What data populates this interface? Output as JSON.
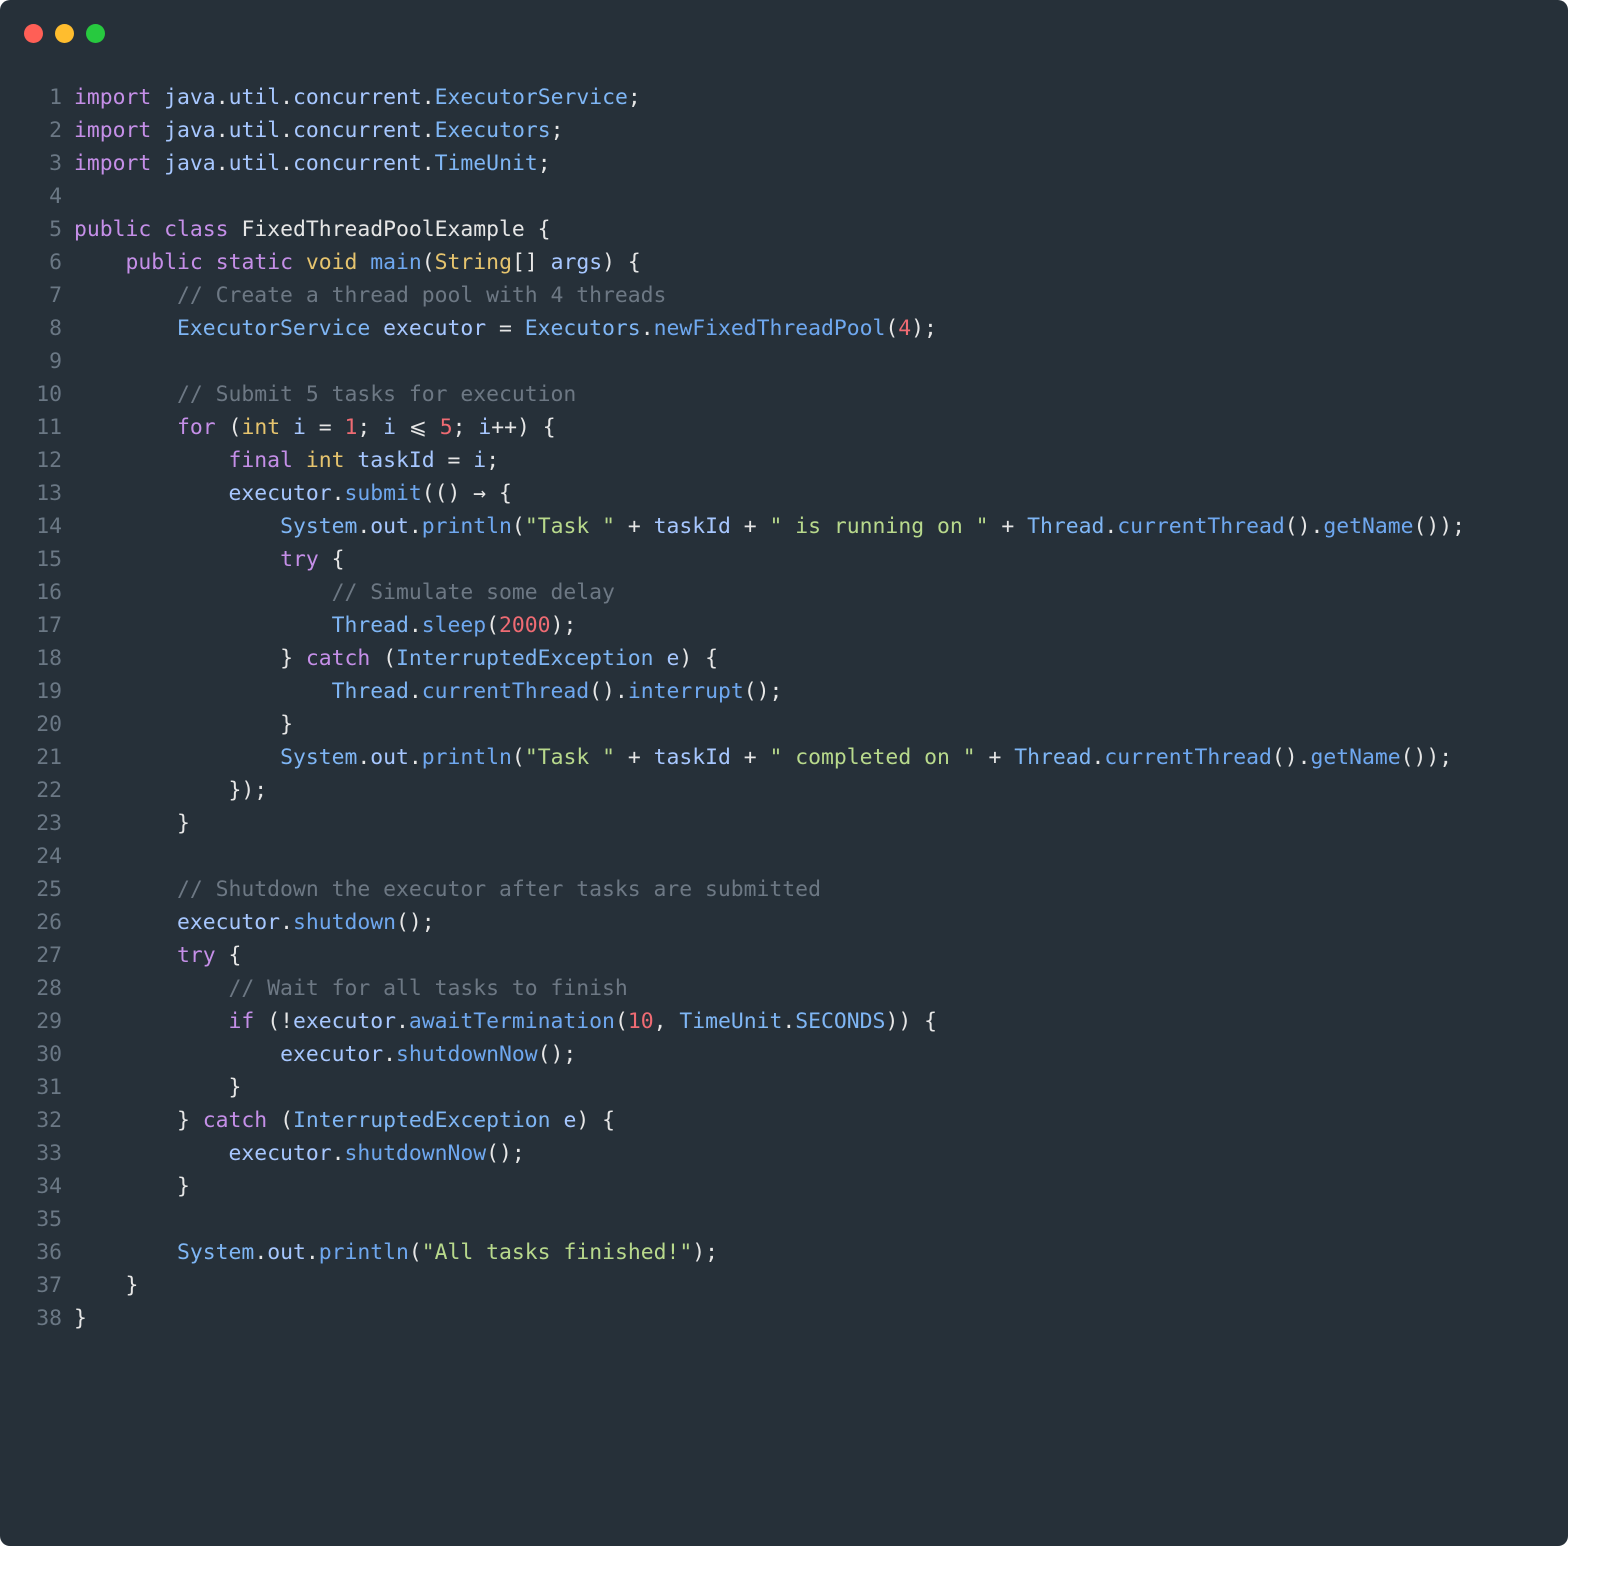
{
  "window": {
    "traffic_lights": [
      {
        "name": "close",
        "color": "#ff5f56"
      },
      {
        "name": "minimize",
        "color": "#ffbd2e"
      },
      {
        "name": "zoom",
        "color": "#27c93f"
      }
    ]
  },
  "editor": {
    "background": "#263039",
    "line_number_color": "#6b7885",
    "colors": {
      "plain": "#e6e6e6",
      "kw": "#c58fe8",
      "type": "#e6c46e",
      "fn": "#6fa8f0",
      "cls": "#7fb6f5",
      "var": "#a7c7ff",
      "num": "#ef6b73",
      "str": "#b8d98c",
      "com": "#6d7884",
      "punc": "#e6e6e6"
    },
    "lines": [
      {
        "n": "1",
        "tokens": [
          [
            "kw",
            "import"
          ],
          [
            "plain",
            " "
          ],
          [
            "var",
            "java"
          ],
          [
            "punc",
            "."
          ],
          [
            "var",
            "util"
          ],
          [
            "punc",
            "."
          ],
          [
            "var",
            "concurrent"
          ],
          [
            "punc",
            "."
          ],
          [
            "cls",
            "ExecutorService"
          ],
          [
            "punc",
            ";"
          ]
        ]
      },
      {
        "n": "2",
        "tokens": [
          [
            "kw",
            "import"
          ],
          [
            "plain",
            " "
          ],
          [
            "var",
            "java"
          ],
          [
            "punc",
            "."
          ],
          [
            "var",
            "util"
          ],
          [
            "punc",
            "."
          ],
          [
            "var",
            "concurrent"
          ],
          [
            "punc",
            "."
          ],
          [
            "cls",
            "Executors"
          ],
          [
            "punc",
            ";"
          ]
        ]
      },
      {
        "n": "3",
        "tokens": [
          [
            "kw",
            "import"
          ],
          [
            "plain",
            " "
          ],
          [
            "var",
            "java"
          ],
          [
            "punc",
            "."
          ],
          [
            "var",
            "util"
          ],
          [
            "punc",
            "."
          ],
          [
            "var",
            "concurrent"
          ],
          [
            "punc",
            "."
          ],
          [
            "cls",
            "TimeUnit"
          ],
          [
            "punc",
            ";"
          ]
        ]
      },
      {
        "n": "4",
        "tokens": []
      },
      {
        "n": "5",
        "tokens": [
          [
            "kw",
            "public"
          ],
          [
            "plain",
            " "
          ],
          [
            "kw",
            "class"
          ],
          [
            "plain",
            " FixedThreadPoolExample {"
          ]
        ]
      },
      {
        "n": "6",
        "tokens": [
          [
            "plain",
            "    "
          ],
          [
            "kw",
            "public"
          ],
          [
            "plain",
            " "
          ],
          [
            "kw",
            "static"
          ],
          [
            "plain",
            " "
          ],
          [
            "type",
            "void"
          ],
          [
            "plain",
            " "
          ],
          [
            "fn",
            "main"
          ],
          [
            "punc",
            "("
          ],
          [
            "type",
            "String"
          ],
          [
            "punc",
            "[] "
          ],
          [
            "var",
            "args"
          ],
          [
            "punc",
            ") {"
          ]
        ]
      },
      {
        "n": "7",
        "tokens": [
          [
            "plain",
            "        "
          ],
          [
            "com",
            "// Create a thread pool with 4 threads"
          ]
        ]
      },
      {
        "n": "8",
        "tokens": [
          [
            "plain",
            "        "
          ],
          [
            "cls",
            "ExecutorService"
          ],
          [
            "plain",
            " "
          ],
          [
            "var",
            "executor"
          ],
          [
            "punc",
            " = "
          ],
          [
            "cls",
            "Executors"
          ],
          [
            "punc",
            "."
          ],
          [
            "fn",
            "newFixedThreadPool"
          ],
          [
            "punc",
            "("
          ],
          [
            "num",
            "4"
          ],
          [
            "punc",
            ");"
          ]
        ]
      },
      {
        "n": "9",
        "tokens": []
      },
      {
        "n": "10",
        "tokens": [
          [
            "plain",
            "        "
          ],
          [
            "com",
            "// Submit 5 tasks for execution"
          ]
        ]
      },
      {
        "n": "11",
        "tokens": [
          [
            "plain",
            "        "
          ],
          [
            "kw",
            "for"
          ],
          [
            "punc",
            " ("
          ],
          [
            "type",
            "int"
          ],
          [
            "plain",
            " "
          ],
          [
            "var",
            "i"
          ],
          [
            "punc",
            " = "
          ],
          [
            "num",
            "1"
          ],
          [
            "punc",
            "; "
          ],
          [
            "var",
            "i"
          ],
          [
            "punc",
            " ⩽ "
          ],
          [
            "num",
            "5"
          ],
          [
            "punc",
            "; "
          ],
          [
            "var",
            "i"
          ],
          [
            "punc",
            "++) {"
          ]
        ]
      },
      {
        "n": "12",
        "tokens": [
          [
            "plain",
            "            "
          ],
          [
            "kw",
            "final"
          ],
          [
            "plain",
            " "
          ],
          [
            "type",
            "int"
          ],
          [
            "plain",
            " "
          ],
          [
            "var",
            "taskId"
          ],
          [
            "punc",
            " = "
          ],
          [
            "var",
            "i"
          ],
          [
            "punc",
            ";"
          ]
        ]
      },
      {
        "n": "13",
        "tokens": [
          [
            "plain",
            "            "
          ],
          [
            "var",
            "executor"
          ],
          [
            "punc",
            "."
          ],
          [
            "fn",
            "submit"
          ],
          [
            "punc",
            "(() → {"
          ]
        ]
      },
      {
        "n": "14",
        "tokens": [
          [
            "plain",
            "                "
          ],
          [
            "cls",
            "System"
          ],
          [
            "punc",
            "."
          ],
          [
            "var",
            "out"
          ],
          [
            "punc",
            "."
          ],
          [
            "fn",
            "println"
          ],
          [
            "punc",
            "("
          ],
          [
            "str",
            "\"Task \""
          ],
          [
            "punc",
            " + "
          ],
          [
            "var",
            "taskId"
          ],
          [
            "punc",
            " + "
          ],
          [
            "str",
            "\" is running on \""
          ],
          [
            "punc",
            " + "
          ],
          [
            "cls",
            "Thread"
          ],
          [
            "punc",
            "."
          ],
          [
            "fn",
            "currentThread"
          ],
          [
            "punc",
            "()."
          ],
          [
            "fn",
            "getName"
          ],
          [
            "punc",
            "());"
          ]
        ]
      },
      {
        "n": "15",
        "tokens": [
          [
            "plain",
            "                "
          ],
          [
            "kw",
            "try"
          ],
          [
            "punc",
            " {"
          ]
        ]
      },
      {
        "n": "16",
        "tokens": [
          [
            "plain",
            "                    "
          ],
          [
            "com",
            "// Simulate some delay"
          ]
        ]
      },
      {
        "n": "17",
        "tokens": [
          [
            "plain",
            "                    "
          ],
          [
            "cls",
            "Thread"
          ],
          [
            "punc",
            "."
          ],
          [
            "fn",
            "sleep"
          ],
          [
            "punc",
            "("
          ],
          [
            "num",
            "2000"
          ],
          [
            "punc",
            ");"
          ]
        ]
      },
      {
        "n": "18",
        "tokens": [
          [
            "plain",
            "                "
          ],
          [
            "punc",
            "} "
          ],
          [
            "kw",
            "catch"
          ],
          [
            "punc",
            " ("
          ],
          [
            "cls",
            "InterruptedException"
          ],
          [
            "plain",
            " "
          ],
          [
            "var",
            "e"
          ],
          [
            "punc",
            ") {"
          ]
        ]
      },
      {
        "n": "19",
        "tokens": [
          [
            "plain",
            "                    "
          ],
          [
            "cls",
            "Thread"
          ],
          [
            "punc",
            "."
          ],
          [
            "fn",
            "currentThread"
          ],
          [
            "punc",
            "()."
          ],
          [
            "fn",
            "interrupt"
          ],
          [
            "punc",
            "();"
          ]
        ]
      },
      {
        "n": "20",
        "tokens": [
          [
            "plain",
            "                "
          ],
          [
            "punc",
            "}"
          ]
        ]
      },
      {
        "n": "21",
        "tokens": [
          [
            "plain",
            "                "
          ],
          [
            "cls",
            "System"
          ],
          [
            "punc",
            "."
          ],
          [
            "var",
            "out"
          ],
          [
            "punc",
            "."
          ],
          [
            "fn",
            "println"
          ],
          [
            "punc",
            "("
          ],
          [
            "str",
            "\"Task \""
          ],
          [
            "punc",
            " + "
          ],
          [
            "var",
            "taskId"
          ],
          [
            "punc",
            " + "
          ],
          [
            "str",
            "\" completed on \""
          ],
          [
            "punc",
            " + "
          ],
          [
            "cls",
            "Thread"
          ],
          [
            "punc",
            "."
          ],
          [
            "fn",
            "currentThread"
          ],
          [
            "punc",
            "()."
          ],
          [
            "fn",
            "getName"
          ],
          [
            "punc",
            "());"
          ]
        ]
      },
      {
        "n": "22",
        "tokens": [
          [
            "plain",
            "            "
          ],
          [
            "punc",
            "});"
          ]
        ]
      },
      {
        "n": "23",
        "tokens": [
          [
            "plain",
            "        "
          ],
          [
            "punc",
            "}"
          ]
        ]
      },
      {
        "n": "24",
        "tokens": []
      },
      {
        "n": "25",
        "tokens": [
          [
            "plain",
            "        "
          ],
          [
            "com",
            "// Shutdown the executor after tasks are submitted"
          ]
        ]
      },
      {
        "n": "26",
        "tokens": [
          [
            "plain",
            "        "
          ],
          [
            "var",
            "executor"
          ],
          [
            "punc",
            "."
          ],
          [
            "fn",
            "shutdown"
          ],
          [
            "punc",
            "();"
          ]
        ]
      },
      {
        "n": "27",
        "tokens": [
          [
            "plain",
            "        "
          ],
          [
            "kw",
            "try"
          ],
          [
            "punc",
            " {"
          ]
        ]
      },
      {
        "n": "28",
        "tokens": [
          [
            "plain",
            "            "
          ],
          [
            "com",
            "// Wait for all tasks to finish"
          ]
        ]
      },
      {
        "n": "29",
        "tokens": [
          [
            "plain",
            "            "
          ],
          [
            "kw",
            "if"
          ],
          [
            "punc",
            " (!"
          ],
          [
            "var",
            "executor"
          ],
          [
            "punc",
            "."
          ],
          [
            "fn",
            "awaitTermination"
          ],
          [
            "punc",
            "("
          ],
          [
            "num",
            "10"
          ],
          [
            "punc",
            ", "
          ],
          [
            "cls",
            "TimeUnit"
          ],
          [
            "punc",
            "."
          ],
          [
            "cls",
            "SECONDS"
          ],
          [
            "punc",
            ")) {"
          ]
        ]
      },
      {
        "n": "30",
        "tokens": [
          [
            "plain",
            "                "
          ],
          [
            "var",
            "executor"
          ],
          [
            "punc",
            "."
          ],
          [
            "fn",
            "shutdownNow"
          ],
          [
            "punc",
            "();"
          ]
        ]
      },
      {
        "n": "31",
        "tokens": [
          [
            "plain",
            "            "
          ],
          [
            "punc",
            "}"
          ]
        ]
      },
      {
        "n": "32",
        "tokens": [
          [
            "plain",
            "        "
          ],
          [
            "punc",
            "} "
          ],
          [
            "kw",
            "catch"
          ],
          [
            "punc",
            " ("
          ],
          [
            "cls",
            "InterruptedException"
          ],
          [
            "plain",
            " "
          ],
          [
            "var",
            "e"
          ],
          [
            "punc",
            ") {"
          ]
        ]
      },
      {
        "n": "33",
        "tokens": [
          [
            "plain",
            "            "
          ],
          [
            "var",
            "executor"
          ],
          [
            "punc",
            "."
          ],
          [
            "fn",
            "shutdownNow"
          ],
          [
            "punc",
            "();"
          ]
        ]
      },
      {
        "n": "34",
        "tokens": [
          [
            "plain",
            "        "
          ],
          [
            "punc",
            "}"
          ]
        ]
      },
      {
        "n": "35",
        "tokens": []
      },
      {
        "n": "36",
        "tokens": [
          [
            "plain",
            "        "
          ],
          [
            "cls",
            "System"
          ],
          [
            "punc",
            "."
          ],
          [
            "var",
            "out"
          ],
          [
            "punc",
            "."
          ],
          [
            "fn",
            "println"
          ],
          [
            "punc",
            "("
          ],
          [
            "str",
            "\"All tasks finished!\""
          ],
          [
            "punc",
            ");"
          ]
        ]
      },
      {
        "n": "37",
        "tokens": [
          [
            "plain",
            "    "
          ],
          [
            "punc",
            "}"
          ]
        ]
      },
      {
        "n": "38",
        "tokens": [
          [
            "punc",
            "}"
          ]
        ]
      }
    ]
  }
}
